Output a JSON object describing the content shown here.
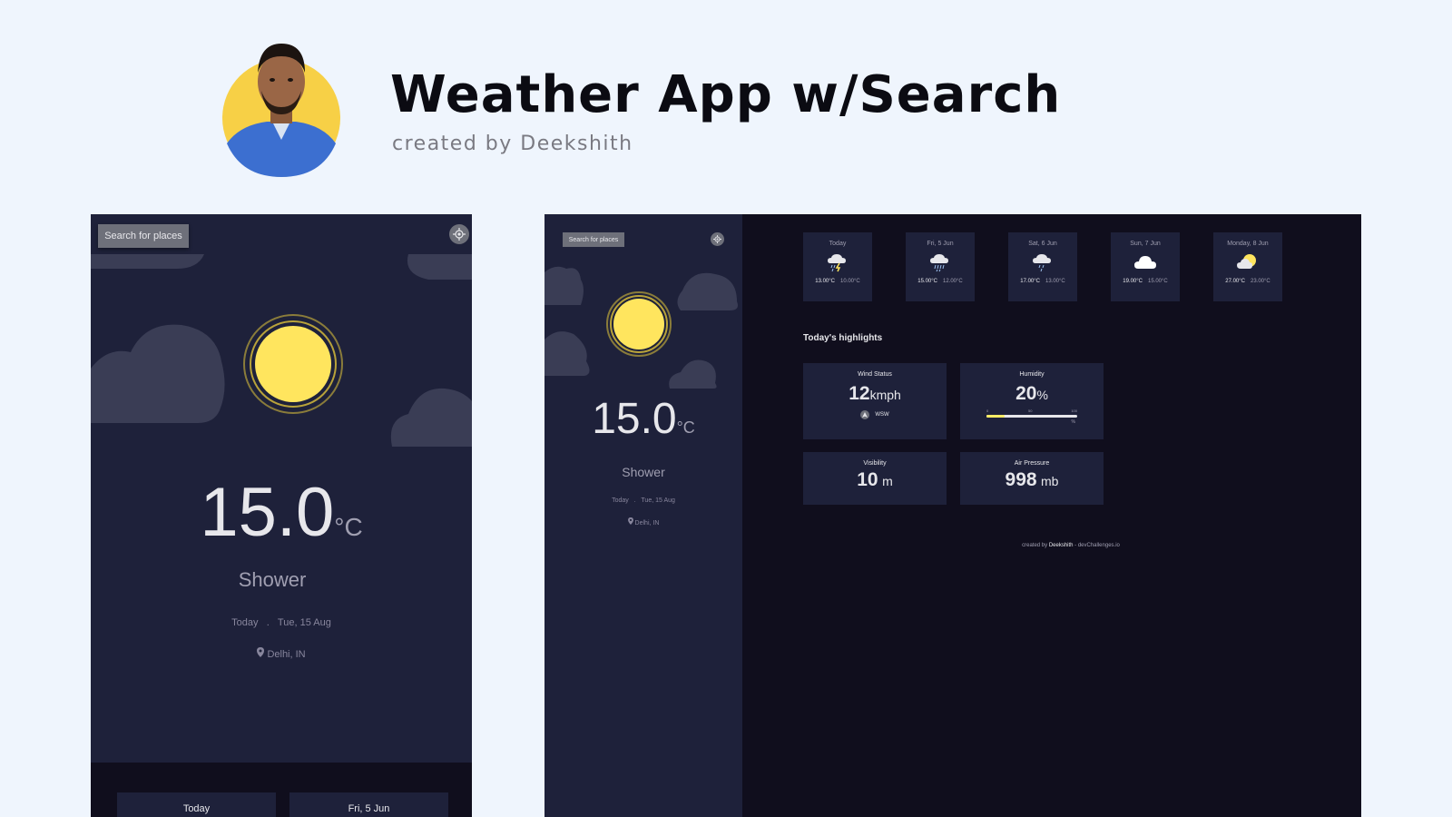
{
  "header": {
    "title": "Weather App w/Search",
    "subtitle": "created by Deekshith"
  },
  "mobile": {
    "search_label": "Search for places",
    "temperature": "15.0",
    "unit": "°C",
    "condition": "Shower",
    "day": "Today",
    "separator": ".",
    "date": "Tue, 15 Aug",
    "location": "Delhi, IN",
    "bottom_cards": [
      "Today",
      "Fri, 5 Jun"
    ]
  },
  "desktop": {
    "search_label": "Search for places",
    "temperature": "15.0",
    "unit": "°C",
    "condition": "Shower",
    "day": "Today",
    "separator": ".",
    "date": "Tue, 15 Aug",
    "location": "Delhi, IN",
    "forecast": [
      {
        "day": "Today",
        "max": "13.00°C",
        "min": "10.00°C",
        "icon": "thunder-rain-icon"
      },
      {
        "day": "Fri, 5 Jun",
        "max": "15.00°C",
        "min": "12.00°C",
        "icon": "heavy-rain-icon"
      },
      {
        "day": "Sat, 6 Jun",
        "max": "17.00°C",
        "min": "13.00°C",
        "icon": "light-rain-icon"
      },
      {
        "day": "Sun, 7 Jun",
        "max": "19.00°C",
        "min": "15.00°C",
        "icon": "cloud-icon"
      },
      {
        "day": "Monday, 8 Jun",
        "max": "27.00°C",
        "min": "23.00°C",
        "icon": "partly-cloudy-icon"
      }
    ],
    "highlights_title": "Today's highlights",
    "wind": {
      "label": "Wind Status",
      "value": "12",
      "unit": "kmph",
      "direction": "WSW"
    },
    "humidity": {
      "label": "Humidity",
      "value": "20",
      "unit": "%",
      "scale_min": "0",
      "scale_mid": "50",
      "scale_max": "100",
      "scale_unit": "%",
      "level": 0.2
    },
    "visibility": {
      "label": "Visibility",
      "value": "10",
      "unit": "m"
    },
    "pressure": {
      "label": "Air Pressure",
      "value": "998",
      "unit": "mb"
    },
    "footer": {
      "prefix": "created by",
      "author": "Deekshith",
      "suffix": "- devChallenges.io"
    }
  },
  "colors": {
    "background": "#eff5fd",
    "panel": "#1e213a",
    "dark": "#100e1d",
    "sun": "#ffe55e",
    "accent_bar": "#ffec65"
  }
}
